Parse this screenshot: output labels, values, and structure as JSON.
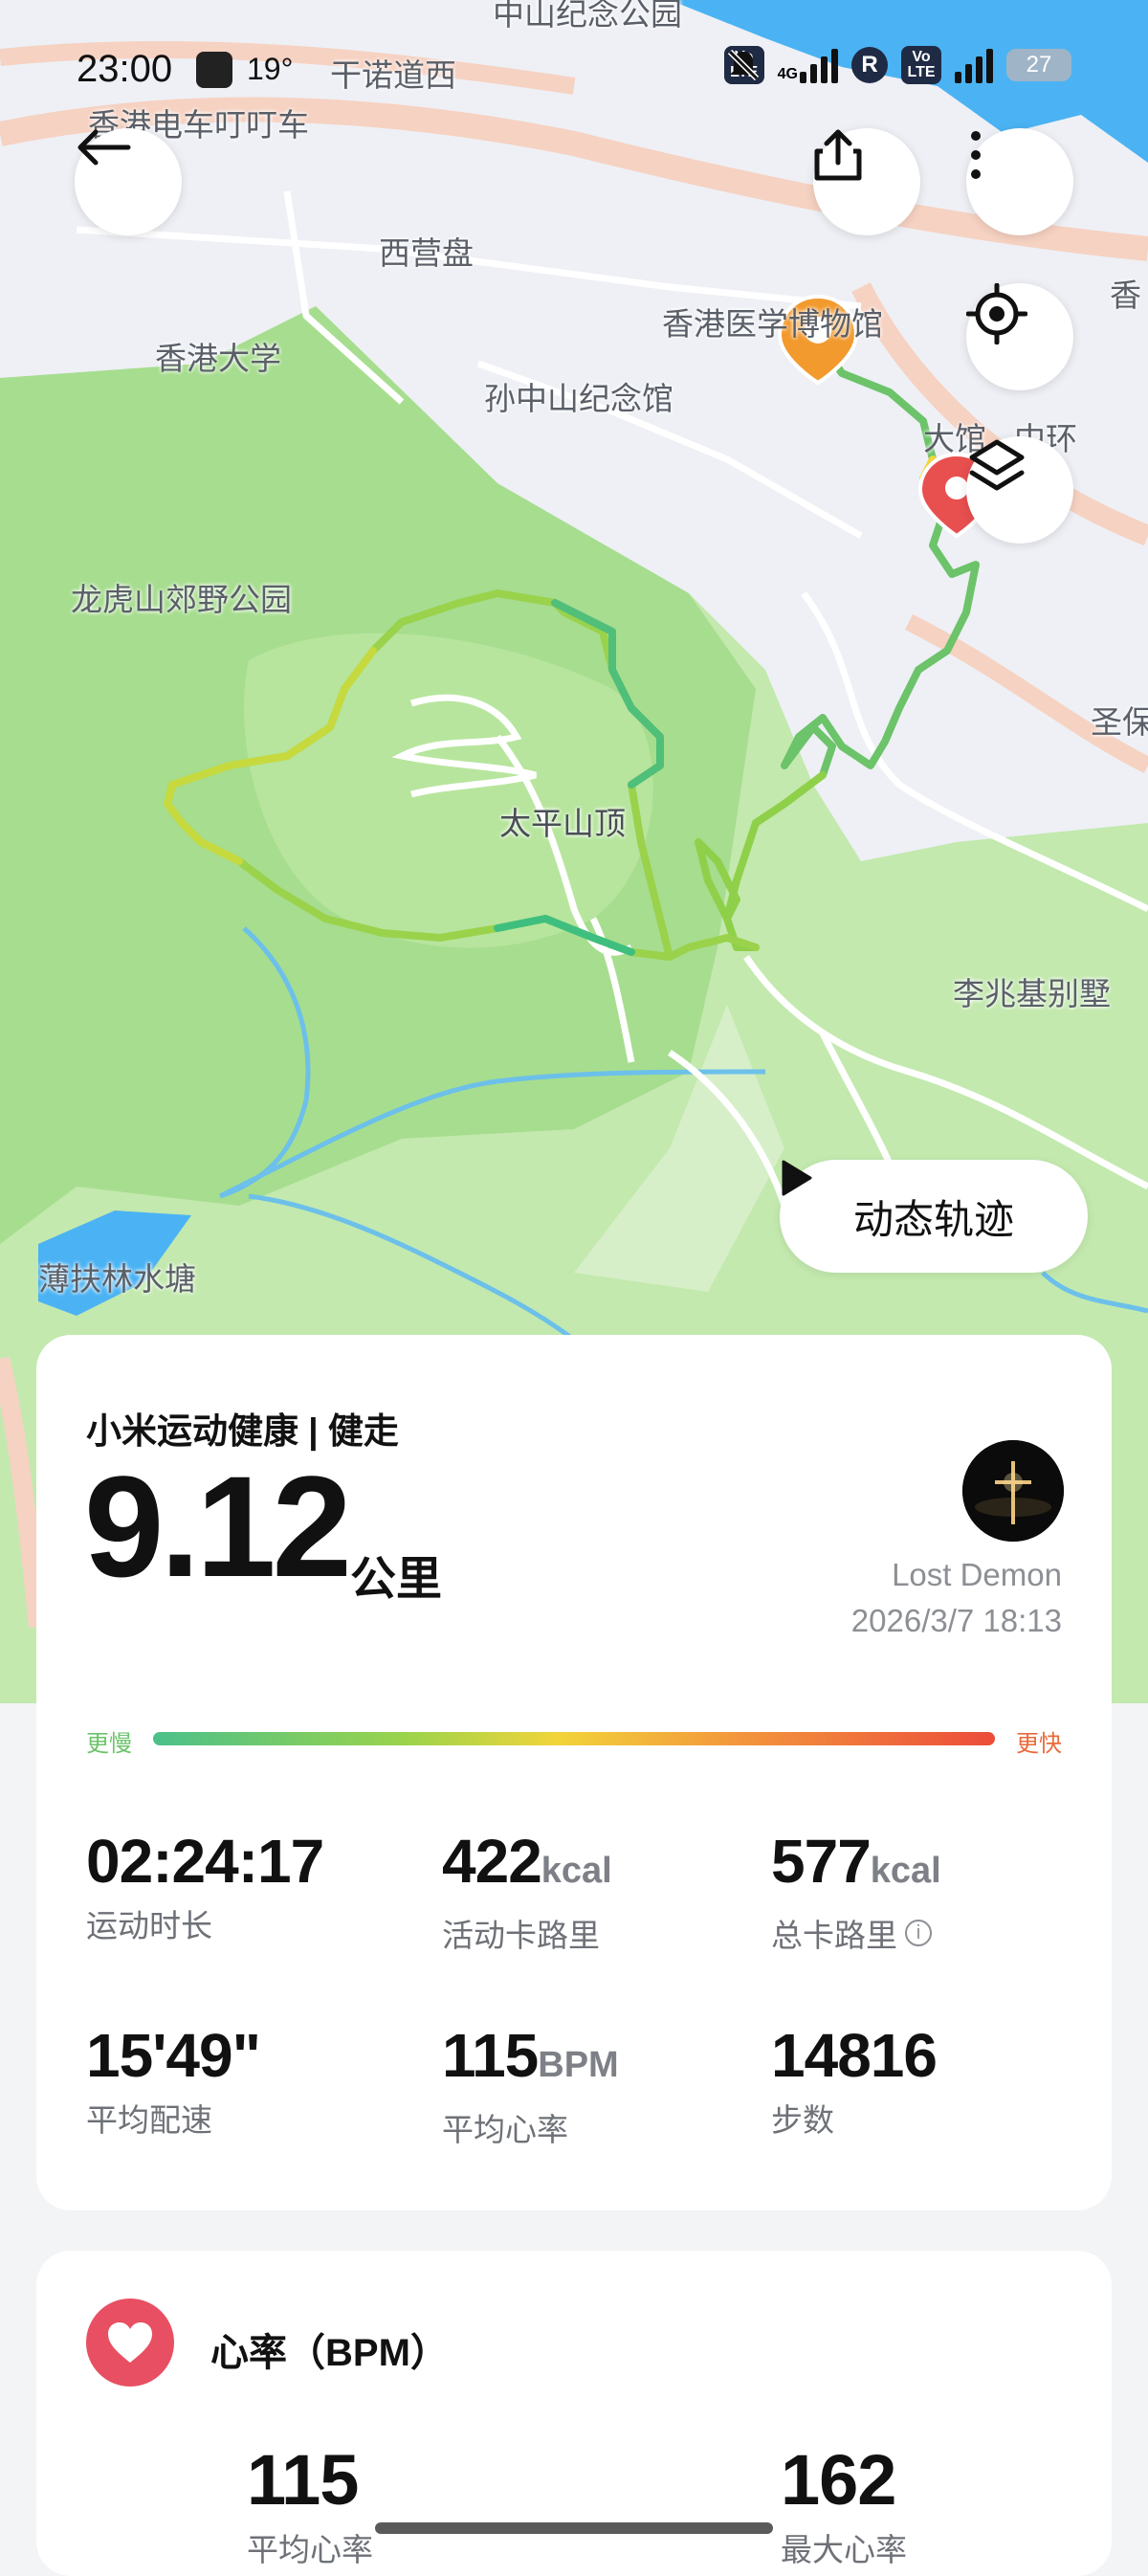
{
  "status_bar": {
    "time": "23:00",
    "temperature": "19°",
    "volte_label": "Vo LTE",
    "network_label": "4G",
    "roaming_label": "R",
    "battery": "27"
  },
  "map": {
    "labels": {
      "l1": "香港电车叮叮车",
      "l2": "西营盘",
      "l3": "香港医学博物馆",
      "l4": "香港大学",
      "l5": "孙中山纪念馆",
      "l6": "大馆",
      "l7": "中环",
      "l8": "龙虎山郊野公园",
      "l9": "太平山顶",
      "l10": "李兆基别墅",
      "l11": "薄扶林水塘",
      "l12": "圣保",
      "l13": "干诺道西",
      "l14": "香"
    },
    "replay_label": "动态轨迹"
  },
  "workout": {
    "source": "小米运动健康 | 健走",
    "distance": "9.12",
    "distance_unit": "公里",
    "user_name": "Lost Demon",
    "datetime": "2026/3/7 18:13",
    "pace_slow_label": "更慢",
    "pace_fast_label": "更快",
    "stats": [
      {
        "value": "02:24:17",
        "unit": "",
        "label": "运动时长"
      },
      {
        "value": "422",
        "unit": "kcal",
        "label": "活动卡路里"
      },
      {
        "value": "577",
        "unit": "kcal",
        "label": "总卡路里"
      },
      {
        "value": "15'49\"",
        "unit": "",
        "label": "平均配速"
      },
      {
        "value": "115",
        "unit": "BPM",
        "label": "平均心率"
      },
      {
        "value": "14816",
        "unit": "",
        "label": "步数"
      }
    ]
  },
  "heart_rate": {
    "title": "心率（BPM）",
    "avg_value": "115",
    "avg_label": "平均心率",
    "max_value": "162",
    "max_label": "最大心率"
  },
  "colors": {
    "route_green": "#6cc36a",
    "park_green": "#bde8a6",
    "water": "#4bb3f3",
    "heart_red": "#e84f62"
  }
}
